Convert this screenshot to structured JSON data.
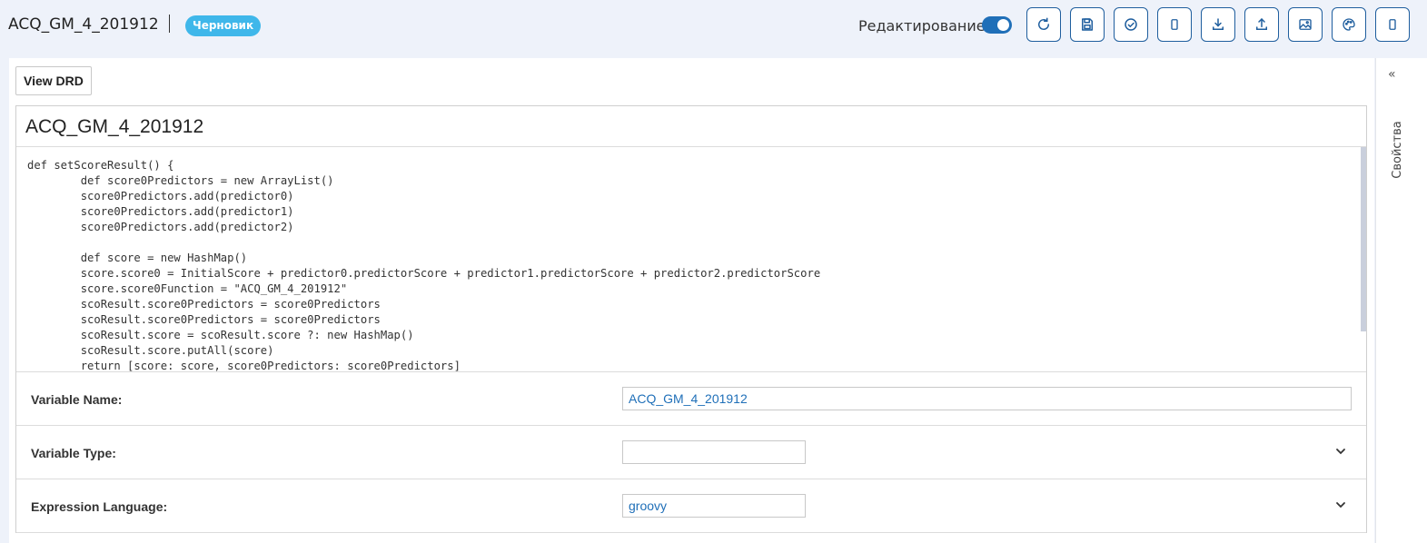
{
  "header": {
    "title": "ACQ_GM_4_201912",
    "status_badge": "Черновик",
    "edit_label": "Редактирование",
    "edit_enabled": true,
    "toolbar": [
      {
        "name": "refresh-button",
        "icon": "refresh-icon"
      },
      {
        "name": "save-button",
        "icon": "save-icon"
      },
      {
        "name": "validate-button",
        "icon": "check-circle-icon"
      },
      {
        "name": "mobile-view-button",
        "icon": "phone-icon"
      },
      {
        "name": "download-button",
        "icon": "download-icon"
      },
      {
        "name": "upload-button",
        "icon": "upload-icon"
      },
      {
        "name": "image-button",
        "icon": "image-icon"
      },
      {
        "name": "palette-button",
        "icon": "palette-icon"
      },
      {
        "name": "device-button",
        "icon": "phone-icon"
      }
    ],
    "accent_color": "#1f6fb8",
    "badge_color": "#3fb7ea"
  },
  "main": {
    "view_drd_label": "View DRD",
    "card_title": "ACQ_GM_4_201912",
    "code": "def setScoreResult() {\n        def score0Predictors = new ArrayList()\n        score0Predictors.add(predictor0)\n        score0Predictors.add(predictor1)\n        score0Predictors.add(predictor2)\n\n        def score = new HashMap()\n        score.score0 = InitialScore + predictor0.predictorScore + predictor1.predictorScore + predictor2.predictorScore\n        score.score0Function = \"ACQ_GM_4_201912\"\n        scoResult.score0Predictors = score0Predictors\n        scoResult.score0Predictors = score0Predictors\n        scoResult.score = scoResult.score ?: new HashMap()\n        scoResult.score.putAll(score)\n        return [score: score, score0Predictors: score0Predictors]",
    "properties": {
      "variable_name": {
        "label": "Variable Name:",
        "value": "ACQ_GM_4_201912"
      },
      "variable_type": {
        "label": "Variable Type:",
        "value": ""
      },
      "expression_language": {
        "label": "Expression Language:",
        "value": "groovy"
      }
    }
  },
  "sidebar": {
    "collapse_glyph": "«",
    "label": "Свойства"
  }
}
